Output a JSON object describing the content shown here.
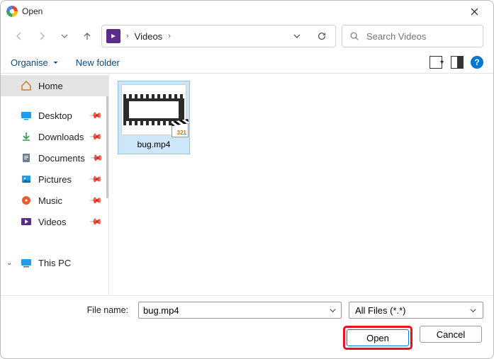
{
  "titlebar": {
    "title": "Open"
  },
  "breadcrumb": {
    "current": "Videos"
  },
  "search": {
    "placeholder": "Search Videos"
  },
  "toolbar": {
    "organise": "Organise",
    "newfolder": "New folder"
  },
  "sidebar": {
    "home": "Home",
    "desktop": "Desktop",
    "downloads": "Downloads",
    "documents": "Documents",
    "pictures": "Pictures",
    "music": "Music",
    "videos": "Videos",
    "thispc": "This PC"
  },
  "files": {
    "item0": "bug.mp4"
  },
  "footer": {
    "filename_label": "File name:",
    "filename_value": "bug.mp4",
    "filter": "All Files (*.*)",
    "open": "Open",
    "cancel": "Cancel"
  }
}
